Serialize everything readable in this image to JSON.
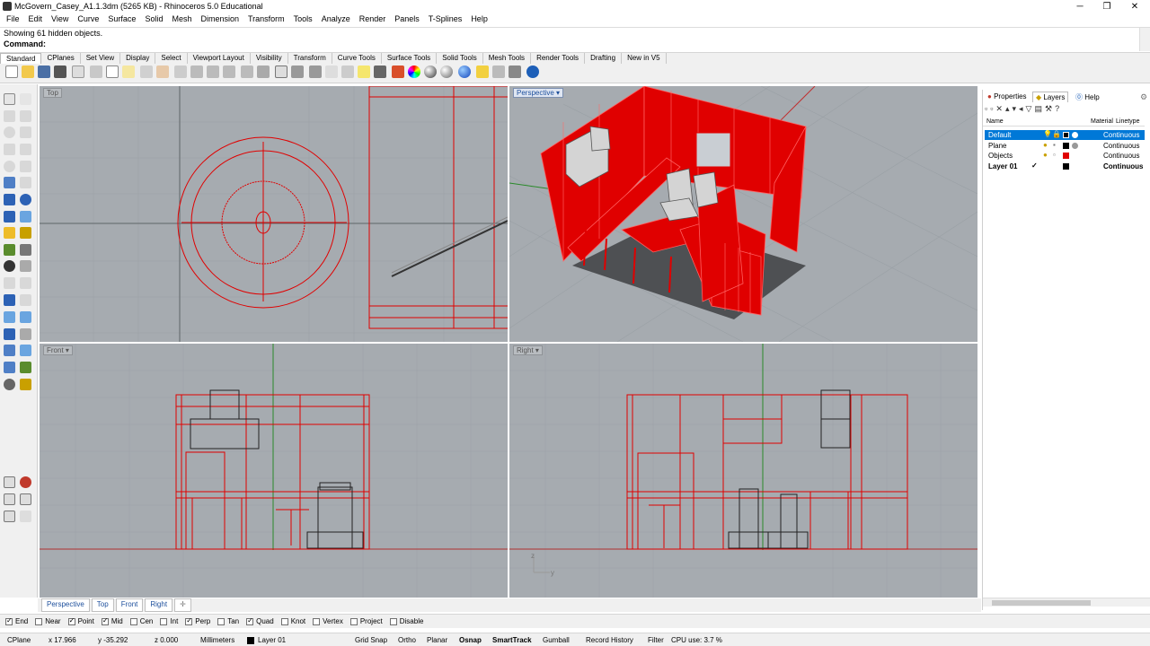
{
  "window": {
    "title": "McGovern_Casey_A1.1.3dm (5265 KB) - Rhinoceros 5.0 Educational",
    "minimize": "─",
    "maximize": "❐",
    "close": "✕"
  },
  "menu": [
    "File",
    "Edit",
    "View",
    "Curve",
    "Surface",
    "Solid",
    "Mesh",
    "Dimension",
    "Transform",
    "Tools",
    "Analyze",
    "Render",
    "Panels",
    "T-Splines",
    "Help"
  ],
  "command": {
    "history": "Showing 61 hidden objects.",
    "prompt": "Command:"
  },
  "toolbar_tabs": [
    "Standard",
    "CPlanes",
    "Set View",
    "Display",
    "Select",
    "Viewport Layout",
    "Visibility",
    "Transform",
    "Curve Tools",
    "Surface Tools",
    "Solid Tools",
    "Mesh Tools",
    "Render Tools",
    "Drafting",
    "New in V5"
  ],
  "viewports": {
    "top": "Top",
    "perspective": "Perspective",
    "front": "Front",
    "right": "Right"
  },
  "viewport_tabs": [
    "Perspective",
    "Top",
    "Front",
    "Right"
  ],
  "axis_labels": {
    "z": "z",
    "y": "y"
  },
  "osnaps": [
    {
      "label": "End",
      "checked": true
    },
    {
      "label": "Near",
      "checked": false
    },
    {
      "label": "Point",
      "checked": true
    },
    {
      "label": "Mid",
      "checked": true
    },
    {
      "label": "Cen",
      "checked": false
    },
    {
      "label": "Int",
      "checked": false
    },
    {
      "label": "Perp",
      "checked": true
    },
    {
      "label": "Tan",
      "checked": false
    },
    {
      "label": "Quad",
      "checked": true
    },
    {
      "label": "Knot",
      "checked": false
    },
    {
      "label": "Vertex",
      "checked": false
    },
    {
      "label": "Project",
      "checked": false
    },
    {
      "label": "Disable",
      "checked": false
    }
  ],
  "status": {
    "cplane": "CPlane",
    "x": "x 17.966",
    "y": "y -35.292",
    "z": "z 0.000",
    "units": "Millimeters",
    "layer": "Layer 01",
    "grid_snap": "Grid Snap",
    "ortho": "Ortho",
    "planar": "Planar",
    "osnap": "Osnap",
    "smarttrack": "SmartTrack",
    "gumball": "Gumball",
    "record_history": "Record History",
    "filter": "Filter",
    "cpu": "CPU use: 3.7 %"
  },
  "panel": {
    "tabs": [
      "Properties",
      "Layers",
      "Help"
    ],
    "columns": {
      "name": "Name",
      "material": "Material",
      "linetype": "Linetype"
    },
    "layers": [
      {
        "name": "Default",
        "color": "#000000",
        "linetype": "Continuous",
        "selected": true
      },
      {
        "name": "Plane",
        "color": "#000000",
        "linetype": "Continuous",
        "selected": false
      },
      {
        "name": "Objects",
        "color": "#e00000",
        "linetype": "Continuous",
        "selected": false
      },
      {
        "name": "Layer 01",
        "color": "#000000",
        "linetype": "Continuous",
        "selected": false,
        "current": true
      }
    ]
  },
  "colors": {
    "wire": "#e00000",
    "viewport_bg": "#a6abb0",
    "selection": "#0078d7"
  }
}
